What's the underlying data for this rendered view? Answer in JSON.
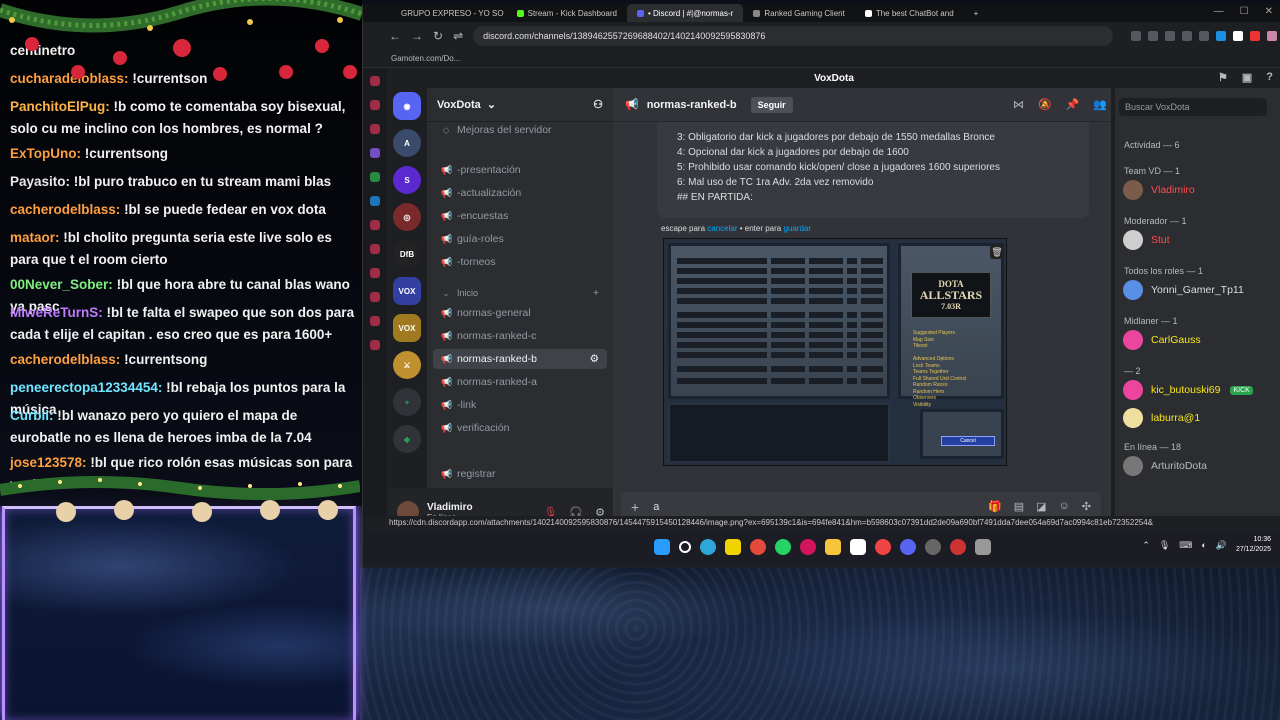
{
  "stream_chat": {
    "messages": [
      {
        "user": "centinetro",
        "text": "",
        "color": "#f0f0f0"
      },
      {
        "user": "cucharadeloblass",
        "text": "!currentson",
        "color": "#ff9f40"
      },
      {
        "user": "PanchitoElPug",
        "text": "!b como te comentaba soy bisexual, solo cu me inclino con los hombres, es normal ?",
        "color": "#ffb347"
      },
      {
        "user": "ExTopUno",
        "text": "!currentsong",
        "color": "#ff9f40"
      },
      {
        "user": "Payasito",
        "text": "!bl puro trabuco en tu stream mami blas",
        "color": "#e8e8e8"
      },
      {
        "user": "cacherodelblass",
        "text": "!bl se puede fedear en vox dota",
        "color": "#ff9f40"
      },
      {
        "user": "mataor",
        "text": "!bl cholito pregunta seria este live solo es para que t el room cierto",
        "color": "#ff9f40"
      },
      {
        "user": "00Never_Sober",
        "text": "!bl que hora abre tu canal blas wano ya pasc",
        "color": "#7ef07e"
      },
      {
        "user": "MiweReTurnS",
        "text": "!bl te falta el swapeo que son dos para cada t elije el capitan . eso creo que es para 1600+",
        "color": "#c07bff"
      },
      {
        "user": "cacherodelblass",
        "text": "!currentsong",
        "color": "#ff9f40"
      },
      {
        "user": "peneerectopa12334454",
        "text": "!bl rebaja los puntos para la música",
        "color": "#6fe6ff"
      },
      {
        "user": "Curbii",
        "text": "!bl wanazo pero yo quiero el mapa de eurobatle no es llena de heroes imba de la 7.04",
        "color": "#6fe6ff"
      },
      {
        "user": "jose123578",
        "text": "!bl que rico rolón esas músicas son para vasiar",
        "color": "#ff9f40"
      }
    ]
  },
  "browser": {
    "tabs": [
      {
        "label": "GRUPO EXPRESO - YO SO",
        "color": "#e04040",
        "active": false
      },
      {
        "label": "Stream - Kick Dashboard",
        "color": "#53fc18",
        "active": false
      },
      {
        "label": "• Discord | #|@normas-r",
        "color": "#5865f2",
        "active": true
      },
      {
        "label": "Ranked Gaming Client",
        "color": "#888888",
        "active": false
      },
      {
        "label": "The best ChatBot and",
        "color": "#ffffff",
        "active": false
      }
    ],
    "url": "discord.com/channels/1389462557269688402/1402140092595830876",
    "bookmark": "Gamoten.com/Do...",
    "ai_label": "AI",
    "status_url": "https://cdn.discordapp.com/attachments/1402140092595830876/1454475915450128446/image.png?ex=695139c1&is=694fe841&hm=b598603c07391dd2de09a690bf7491dda7dee054a69d7ac0994c81eb72352254&"
  },
  "discord": {
    "window_title": "VoxDota",
    "server_name": "VoxDota",
    "server_boost": "Mejoras del servidor",
    "channels": [
      {
        "name": "-presentación",
        "icon": "#",
        "active": false
      },
      {
        "name": "-actualización",
        "icon": "#",
        "active": false
      },
      {
        "name": "-encuestas",
        "icon": "#",
        "active": false
      },
      {
        "name": "guía-roles",
        "icon": "#",
        "active": false
      },
      {
        "name": "-torneos",
        "icon": "#",
        "active": false
      },
      {
        "name": "Inicio",
        "icon": "v",
        "active": false,
        "category": true
      },
      {
        "name": "normas-general",
        "icon": "#",
        "active": false
      },
      {
        "name": "normas-ranked-c",
        "icon": "#",
        "active": false
      },
      {
        "name": "normas-ranked-b",
        "icon": "#",
        "active": true
      },
      {
        "name": "normas-ranked-a",
        "icon": "#",
        "active": false
      },
      {
        "name": "-link",
        "icon": "#",
        "active": false
      },
      {
        "name": "verificación",
        "icon": "#",
        "active": false
      },
      {
        "name": "registrar",
        "icon": "#",
        "active": false
      }
    ],
    "current_channel": "normas-ranked-b",
    "follow_label": "Seguir",
    "search_placeholder": "Buscar VoxDota",
    "edit_lines": [
      "3: Obligatorio dar  kick a jugadores por debajo de 1550 medallas  Bronce",
      "4: Opcional dar kick a jugadores por debajo de 1600",
      "5: Prohibido usar comando kick/open/ close a jugadores 1600 superiores",
      "6: Mal uso de TC 1ra Adv.  2da vez removido",
      "## EN PARTIDA:"
    ],
    "edit_hint": {
      "pre": "escape para ",
      "cancel": "cancelar",
      "mid": " • enter para ",
      "save": "guardar"
    },
    "message_input": "a",
    "user": {
      "name": "Vladimiro",
      "status": "En línea"
    },
    "game_image": {
      "logo_top": "DOTA",
      "logo_mid": "ALLSTARS",
      "logo_ver": "7.03R",
      "options": [
        "Suggested Players",
        "Map Size",
        "Tileset",
        "",
        "Advanced Options",
        "Lock Teams",
        "Teams Together",
        "Full Shared Unit Control",
        "Random Races",
        "Random Hero",
        "Observers",
        "Visibility"
      ],
      "cancel_label": "Cancel"
    },
    "members": {
      "activity_label": "Actividad — 6",
      "groups": [
        {
          "label": "Team VD — 1",
          "members": [
            {
              "name": "Vladimiro",
              "color": "#ff4d4d",
              "avatar": "#7b5b4a"
            }
          ]
        },
        {
          "label": "Moderador — 1",
          "members": [
            {
              "name": "Stut",
              "color": "#ff4d4d",
              "avatar": "#cfcfcf"
            }
          ]
        },
        {
          "label": "Todos los roles — 1",
          "members": [
            {
              "name": "Yonni_Gamer_Tp11",
              "color": "#dbdee1",
              "avatar": "#5a8fe8"
            }
          ]
        },
        {
          "label": "Midlaner — 1",
          "members": [
            {
              "name": "CarlGauss",
              "color": "#f8e71c",
              "avatar": "#eb459e"
            }
          ]
        },
        {
          "label": "— 2",
          "members": [
            {
              "name": "kic_butouski69",
              "color": "#f8e71c",
              "avatar": "#eb459e",
              "badge": "KICK"
            },
            {
              "name": "laburra@1",
              "color": "#f8e71c",
              "avatar": "#f0e0a0"
            }
          ]
        }
      ],
      "online_label": "En línea — 18",
      "online_first": {
        "name": "ArturitoDota",
        "color": "#b5bac1",
        "avatar": "#777777"
      }
    }
  },
  "taskbar": {
    "time": "10:36",
    "date": "27/12/2025"
  }
}
